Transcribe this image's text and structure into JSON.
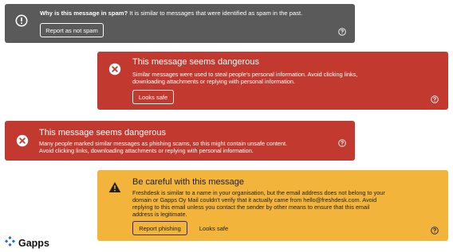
{
  "spam_banner": {
    "question": "Why is this message in spam?",
    "explanation": " It is similar to messages that were identified as spam in the past.",
    "button_label": "Report as not spam",
    "icon": "exclamation-circle-icon"
  },
  "danger_banner_1": {
    "title": "This message seems dangerous",
    "body": "Similar messages were used to steal people's personal information. Avoid clicking links, downloading attachments or replying with personal information.",
    "button_label": "Looks safe",
    "icon": "x-circle-icon"
  },
  "danger_banner_2": {
    "title": "This message seems dangerous",
    "body": "Many people marked similar messages as phishing scams, so this might contain unsafe content. Avoid clicking links, downloading attachments or replying with personal information.",
    "icon": "x-circle-icon"
  },
  "careful_banner": {
    "title": "Be careful with this message",
    "body": "Freshdesk is similar to a name in your organisation, but the email address does not belong to your domain or Gapps Oy Mail couldn't verify that it actually came from hello@freshdesk.com. Avoid replying to this email unless you contact the sender by other means to ensure that this email address is legitimate.",
    "report_button_label": "Report phishing",
    "safe_button_label": "Looks safe",
    "icon": "warning-triangle-icon"
  },
  "logo": {
    "text": "Gapps"
  },
  "colors": {
    "spam_bg": "#5a5a5a",
    "danger_bg": "#c2392f",
    "warning_bg": "#f2b43a",
    "logo_blue": "#1a6fd6"
  }
}
